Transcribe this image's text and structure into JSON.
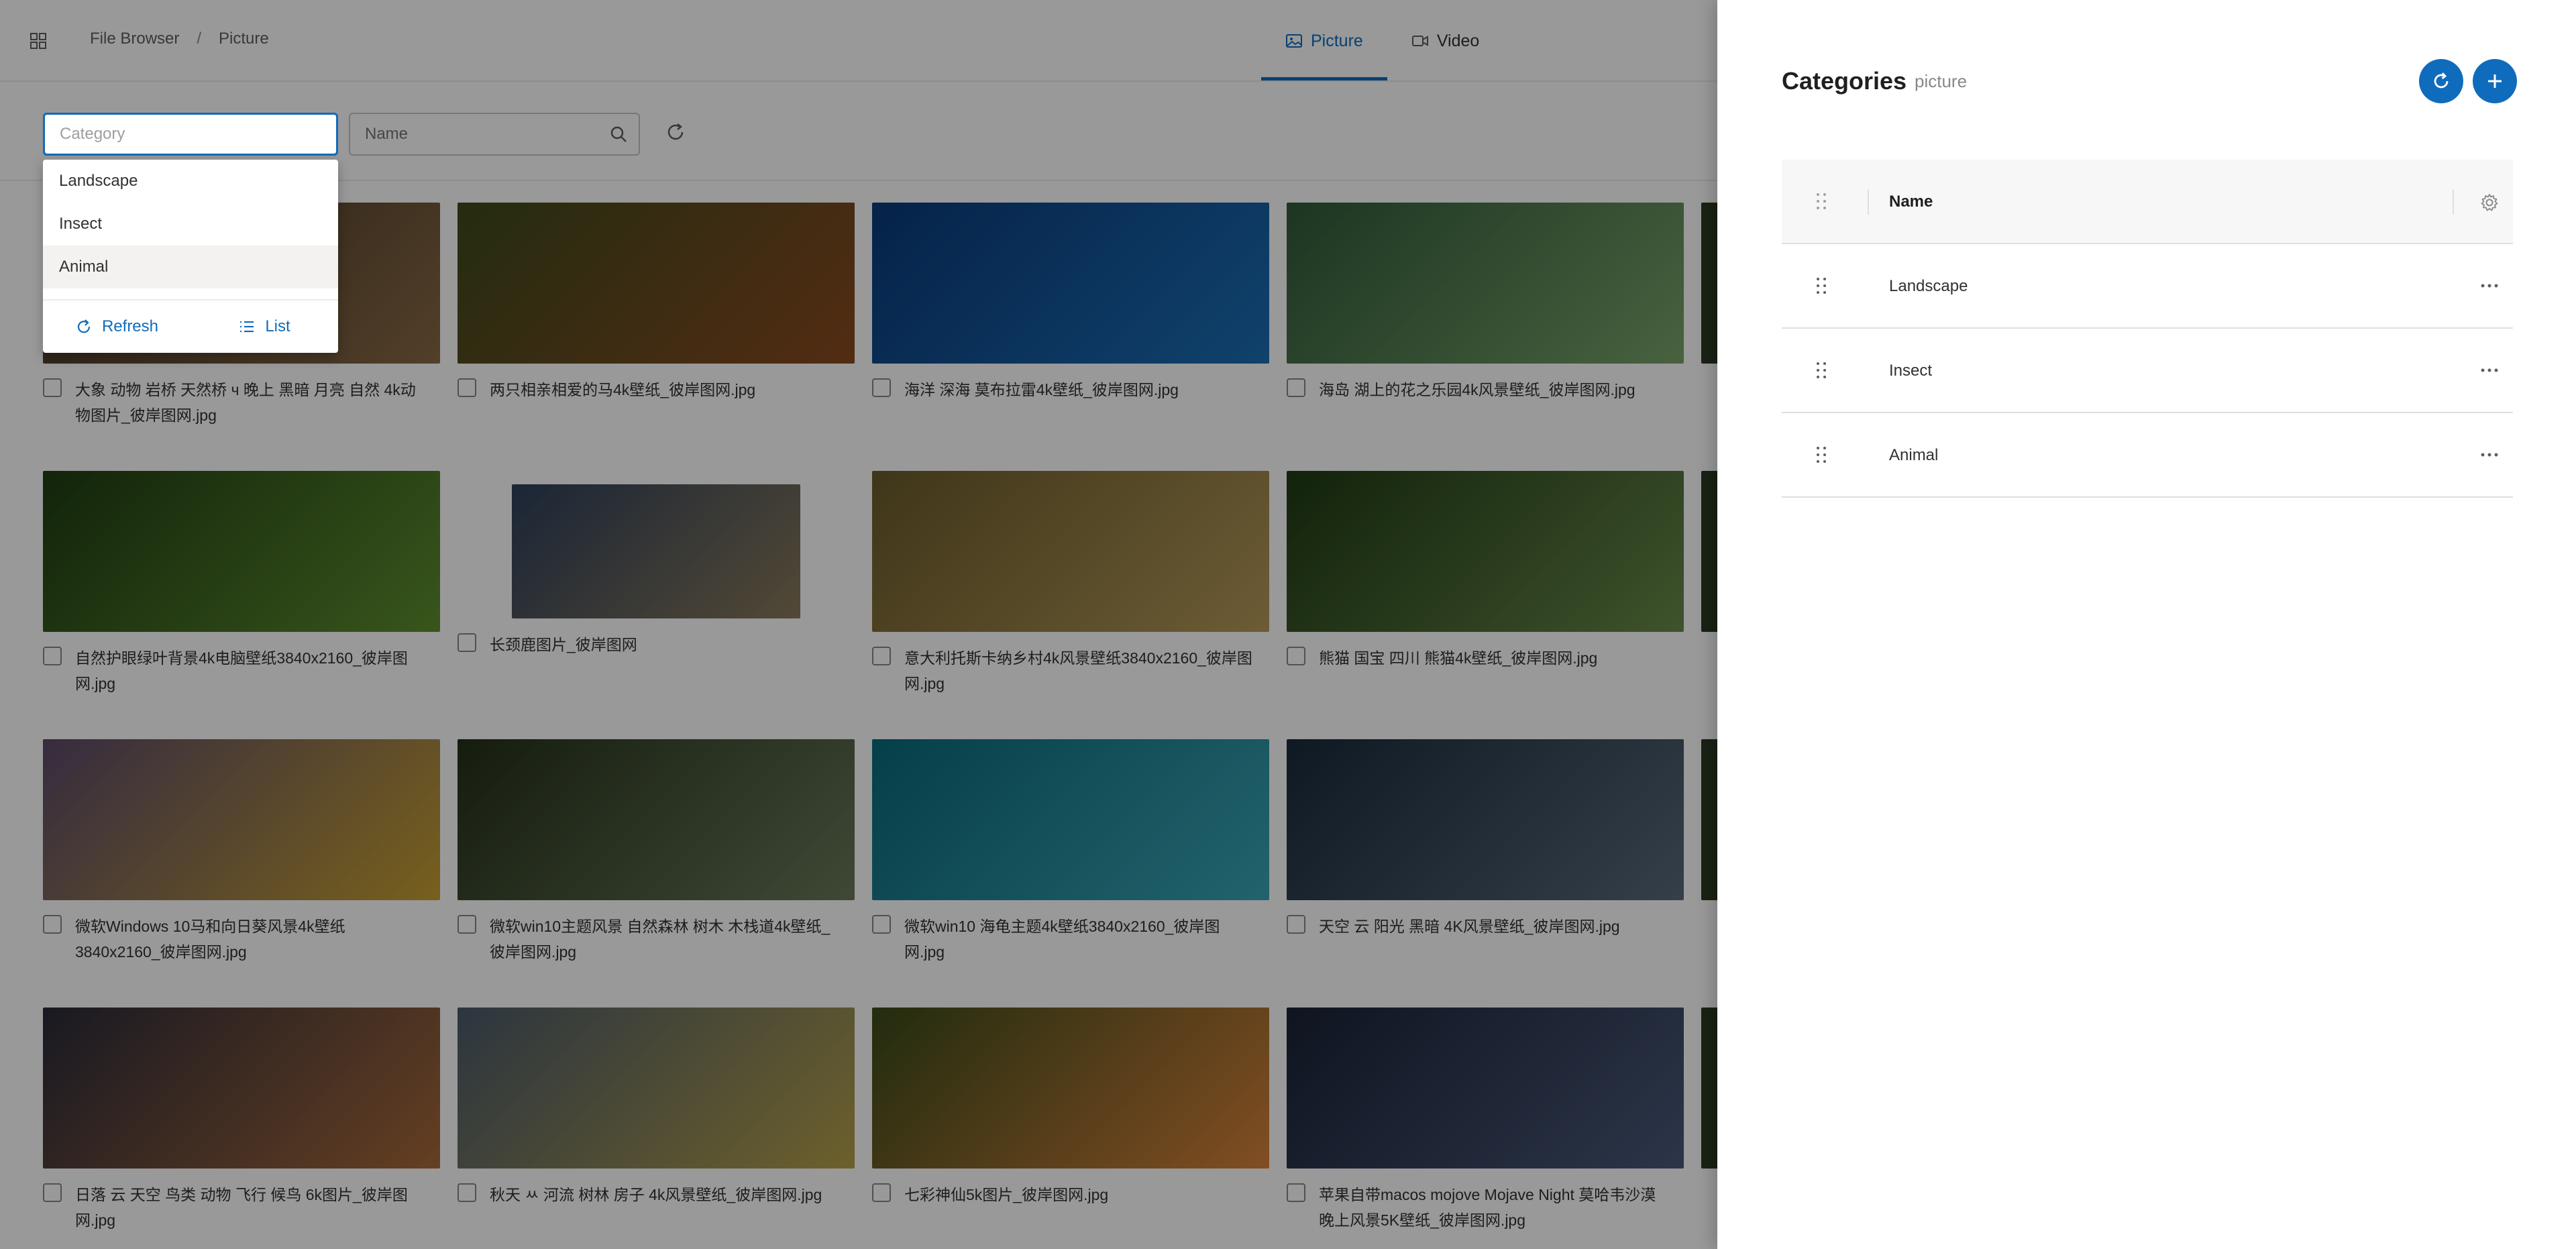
{
  "breadcrumb": {
    "root": "File Browser",
    "current": "Picture"
  },
  "tabs": [
    {
      "label": "Picture",
      "icon": "image-icon",
      "active": true
    },
    {
      "label": "Video",
      "icon": "video-icon",
      "active": false
    }
  ],
  "filters": {
    "category_placeholder": "Category",
    "name_placeholder": "Name"
  },
  "dropdown": {
    "options": [
      "Landscape",
      "Insect",
      "Animal"
    ],
    "highlighted": "Animal",
    "refresh_label": "Refresh",
    "list_label": "List"
  },
  "gallery": [
    {
      "caption": "大象 动物 岩桥 天然桥 ч 晚上 黑暗 月亮 自然 4k动物图片_彼岸图网.jpg",
      "colors": [
        "#3b2f22",
        "#8a6a45"
      ]
    },
    {
      "caption": "两只相亲相爱的马4k壁纸_彼岸图网.jpg",
      "colors": [
        "#3d4a1c",
        "#8a4a20"
      ]
    },
    {
      "caption": "海洋 深海 莫布拉雷4k壁纸_彼岸图网.jpg",
      "colors": [
        "#0a3a7a",
        "#1b6fb5"
      ]
    },
    {
      "caption": "海岛 湖上的花之乐园4k风景壁纸_彼岸图网.jpg",
      "colors": [
        "#2f5a3a",
        "#7aa36a"
      ]
    },
    {
      "caption": "自然护眼绿叶背景4k电脑壁纸3840x2160_彼岸图网.jpg",
      "colors": [
        "#1f3d12",
        "#5f8f2f"
      ]
    },
    {
      "caption": "长颈鹿图片_彼岸图网",
      "colors": [
        "#2d3f5a",
        "#8a7a5a"
      ]
    },
    {
      "caption": "意大利托斯卡纳乡村4k风景壁纸3840x2160_彼岸图网.jpg",
      "colors": [
        "#6a5a2a",
        "#b59a5a"
      ]
    },
    {
      "caption": "熊猫 国宝 四川 熊猫4k壁纸_彼岸图网.jpg",
      "colors": [
        "#1f3a14",
        "#6a8a4a"
      ]
    },
    {
      "caption": "微软Windows 10马和向日葵风景4k壁纸3840x2160_彼岸图网.jpg",
      "colors": [
        "#5a4a6a",
        "#c8a030"
      ]
    },
    {
      "caption": "微软win10主题风景 自然森林 树木 木栈道4k壁纸_彼岸图网.jpg",
      "colors": [
        "#24301a",
        "#6a7a5a"
      ]
    },
    {
      "caption": "微软win10 海龟主题4k壁纸3840x2160_彼岸图网.jpg",
      "colors": [
        "#0a6a7a",
        "#3aa5b5"
      ]
    },
    {
      "caption": "天空 云 阳光 黑暗 4K风景壁纸_彼岸图网.jpg",
      "colors": [
        "#1a2a3a",
        "#5a6a7a"
      ]
    },
    {
      "caption": "日落 云 天空 鸟类 动物 飞行 候鸟 6k图片_彼岸图网.jpg",
      "colors": [
        "#2a2a3a",
        "#a86a3a"
      ]
    },
    {
      "caption": "秋天 ㅆ 河流 树林 房子 4k风景壁纸_彼岸图网.jpg",
      "colors": [
        "#4a5a6a",
        "#b5a04a"
      ]
    },
    {
      "caption": "七彩神仙5k图片_彼岸图网.jpg",
      "colors": [
        "#3a4a1a",
        "#d8823a"
      ]
    },
    {
      "caption": "苹果自带macos mojove Mojave Night 莫哈韦沙漠晚上风景5K壁纸_彼岸图网.jpg",
      "colors": [
        "#1a2236",
        "#4a5a7a"
      ]
    }
  ],
  "panel": {
    "title": "Categories",
    "subtitle": "picture",
    "column_name": "Name",
    "rows": [
      "Landscape",
      "Insect",
      "Animal"
    ],
    "accent": "#0f6cbd"
  }
}
